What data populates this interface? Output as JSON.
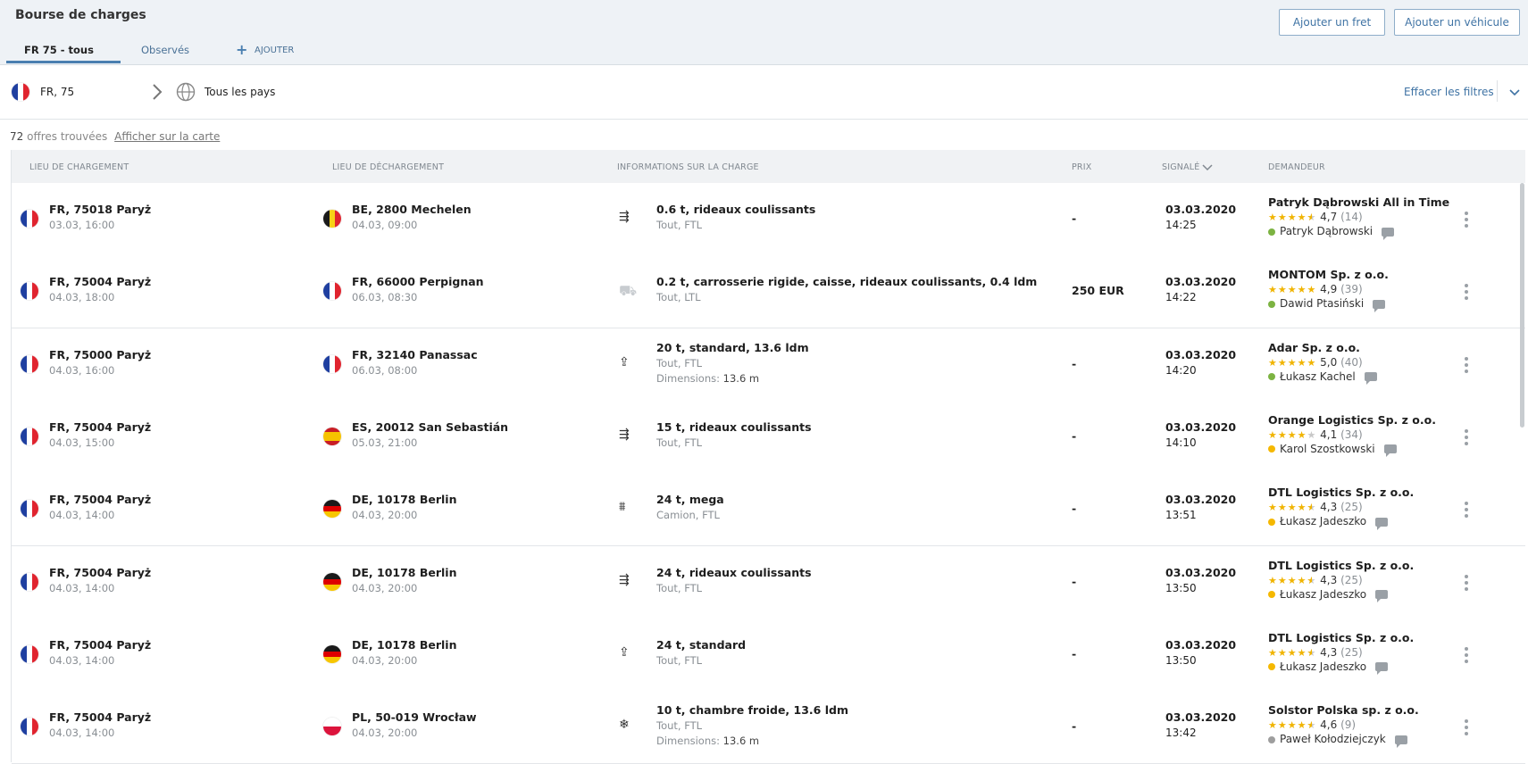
{
  "app": {
    "title": "Bourse de charges"
  },
  "tabs": [
    {
      "label": "FR 75 - tous",
      "active": true
    },
    {
      "label": "Observés",
      "active": false
    }
  ],
  "add_tab": {
    "label": "AJOUTER",
    "icon": "plus-icon"
  },
  "buttons": {
    "add_freight": "Ajouter un fret",
    "add_vehicle": "Ajouter un véhicule"
  },
  "filters": {
    "origin": "FR, 75",
    "destination": "Tous les pays",
    "clear": "Effacer les filtres"
  },
  "results": {
    "count": "72",
    "found_label": "offres trouvées",
    "map_link": "Afficher sur la carte"
  },
  "columns": {
    "loading": "LIEU DE CHARGEMENT",
    "unloading": "LIEU DE DÉCHARGEMENT",
    "info": "INFORMATIONS SUR LA CHARGE",
    "price": "PRIX",
    "reported": "SIGNALÉ",
    "requester": "DEMANDEUR"
  },
  "colors": {
    "accent": "#3f73a4",
    "star": "#f0b400",
    "status_green": "#7cb342",
    "status_yellow": "#f5b800",
    "status_gray": "#9e9e9e"
  },
  "rows": [
    {
      "load_flag": "FR",
      "load_place": "FR, 75018 Paryż",
      "load_time": "03.03, 16:00",
      "unload_flag": "BE",
      "unload_place": "BE, 2800 Mechelen",
      "unload_time": "04.03, 09:00",
      "icon": "curtain-truck-icon",
      "cargo": "0.6 t, rideaux coulissants",
      "cargo_sub": "Tout, FTL",
      "dimensions_label": "",
      "dimensions": "",
      "price": "-",
      "date": "03.03.2020",
      "time": "14:25",
      "company": "Patryk Dąbrowski All in Time",
      "stars": 4.5,
      "rating": "4,7",
      "reviews": "(14)",
      "status": "green",
      "person": "Patryk Dąbrowski"
    },
    {
      "load_flag": "FR",
      "load_place": "FR, 75004 Paryż",
      "load_time": "04.03, 18:00",
      "unload_flag": "FR",
      "unload_place": "FR, 66000 Perpignan",
      "unload_time": "06.03, 08:30",
      "icon": "truck-outline-icon",
      "cargo": "0.2 t, carrosserie rigide, caisse, rideaux coulissants, 0.4 ldm",
      "cargo_sub": "Tout, LTL",
      "dimensions_label": "",
      "dimensions": "",
      "price": "250 EUR",
      "date": "03.03.2020",
      "time": "14:22",
      "company": "MONTOM Sp. z o.o.",
      "stars": 5,
      "rating": "4,9",
      "reviews": "(39)",
      "status": "green",
      "person": "Dawid Ptasiński"
    },
    {
      "load_flag": "FR",
      "load_place": "FR, 75000 Paryż",
      "load_time": "04.03, 16:00",
      "unload_flag": "FR",
      "unload_place": "FR, 32140 Panassac",
      "unload_time": "06.03, 08:00",
      "icon": "standard-load-icon",
      "cargo": "20 t, standard, 13.6 ldm",
      "cargo_sub": "Tout, FTL",
      "dimensions_label": "Dimensions:",
      "dimensions": "13.6 m",
      "price": "-",
      "date": "03.03.2020",
      "time": "14:20",
      "company": "Adar Sp. z o.o.",
      "stars": 5,
      "rating": "5,0",
      "reviews": "(40)",
      "status": "green",
      "person": "Łukasz Kachel"
    },
    {
      "load_flag": "FR",
      "load_place": "FR, 75004 Paryż",
      "load_time": "04.03, 15:00",
      "unload_flag": "ES",
      "unload_place": "ES, 20012 San Sebastián",
      "unload_time": "05.03, 21:00",
      "icon": "curtain-truck-icon",
      "cargo": "15 t, rideaux coulissants",
      "cargo_sub": "Tout, FTL",
      "dimensions_label": "",
      "dimensions": "",
      "price": "-",
      "date": "03.03.2020",
      "time": "14:10",
      "company": "Orange Logistics Sp. z o.o.",
      "stars": 4,
      "rating": "4,1",
      "reviews": "(34)",
      "status": "yellow",
      "person": "Karol Szostkowski"
    },
    {
      "load_flag": "FR",
      "load_place": "FR, 75004 Paryż",
      "load_time": "04.03, 14:00",
      "unload_flag": "DE",
      "unload_place": "DE, 10178 Berlin",
      "unload_time": "04.03, 20:00",
      "icon": "mega-trailer-icon",
      "cargo": "24 t, mega",
      "cargo_sub": "Camion, FTL",
      "dimensions_label": "",
      "dimensions": "",
      "price": "-",
      "date": "03.03.2020",
      "time": "13:51",
      "company": "DTL Logistics Sp. z o.o.",
      "stars": 4.5,
      "rating": "4,3",
      "reviews": "(25)",
      "status": "yellow",
      "person": "Łukasz Jadeszko"
    },
    {
      "load_flag": "FR",
      "load_place": "FR, 75004 Paryż",
      "load_time": "04.03, 14:00",
      "unload_flag": "DE",
      "unload_place": "DE, 10178 Berlin",
      "unload_time": "04.03, 20:00",
      "icon": "curtain-truck-icon",
      "cargo": "24 t, rideaux coulissants",
      "cargo_sub": "Tout, FTL",
      "dimensions_label": "",
      "dimensions": "",
      "price": "-",
      "date": "03.03.2020",
      "time": "13:50",
      "company": "DTL Logistics Sp. z o.o.",
      "stars": 4.5,
      "rating": "4,3",
      "reviews": "(25)",
      "status": "yellow",
      "person": "Łukasz Jadeszko"
    },
    {
      "load_flag": "FR",
      "load_place": "FR, 75004 Paryż",
      "load_time": "04.03, 14:00",
      "unload_flag": "DE",
      "unload_place": "DE, 10178 Berlin",
      "unload_time": "04.03, 20:00",
      "icon": "standard-load-icon",
      "cargo": "24 t, standard",
      "cargo_sub": "Tout, FTL",
      "dimensions_label": "",
      "dimensions": "",
      "price": "-",
      "date": "03.03.2020",
      "time": "13:50",
      "company": "DTL Logistics Sp. z o.o.",
      "stars": 4.5,
      "rating": "4,3",
      "reviews": "(25)",
      "status": "yellow",
      "person": "Łukasz Jadeszko"
    },
    {
      "load_flag": "FR",
      "load_place": "FR, 75004 Paryż",
      "load_time": "04.03, 14:00",
      "unload_flag": "PL",
      "unload_place": "PL, 50-019 Wrocław",
      "unload_time": "04.03, 20:00",
      "icon": "snowflake-icon",
      "cargo": "10 t, chambre froide, 13.6 ldm",
      "cargo_sub": "Tout, FTL",
      "dimensions_label": "Dimensions:",
      "dimensions": "13.6 m",
      "price": "-",
      "date": "03.03.2020",
      "time": "13:42",
      "company": "Solstor Polska sp. z o.o.",
      "stars": 4.5,
      "rating": "4,6",
      "reviews": "(9)",
      "status": "gray",
      "person": "Paweł Kołodziejczyk"
    }
  ]
}
